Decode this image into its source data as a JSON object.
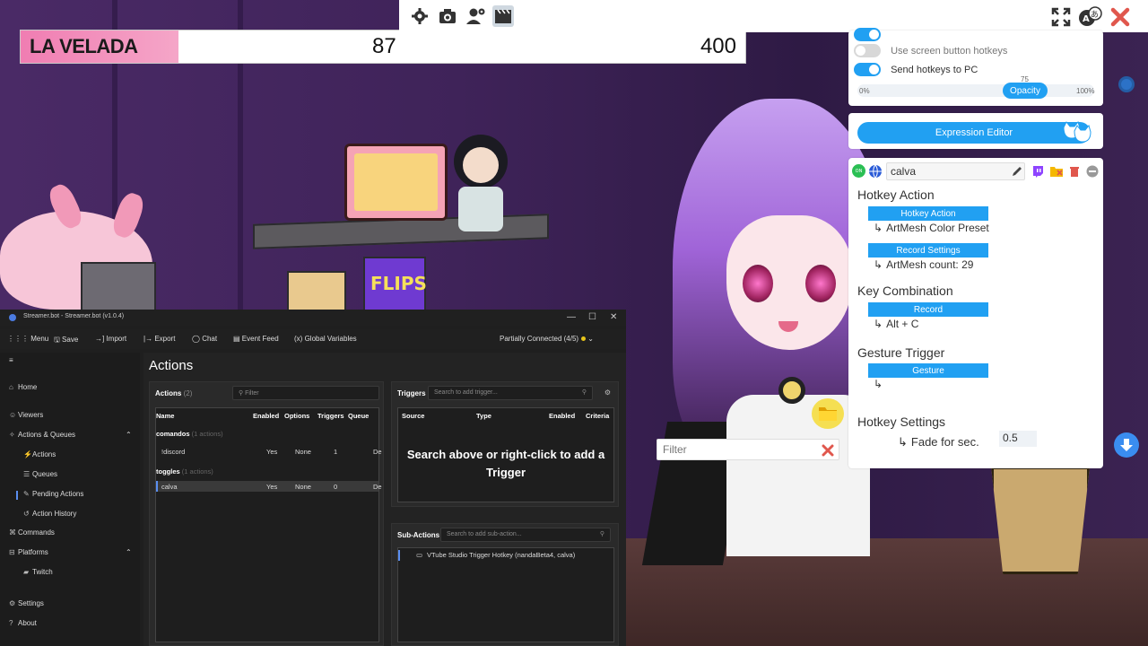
{
  "scoreboard": {
    "title": "LA VELADA",
    "value_left": "87",
    "value_right": "400"
  },
  "scene": {
    "box_label": "FLIPS"
  },
  "vtube": {
    "toolbar_icons": [
      "gear-icon",
      "camera-icon",
      "user-gear-icon",
      "clapperboard-icon"
    ],
    "right_icons": [
      "fullscreen-icon",
      "translate-icon",
      "close-icon"
    ],
    "settings": {
      "use_screen_button_hotkeys": "Use screen button hotkeys",
      "send_hotkeys_to_pc": "Send hotkeys to PC",
      "opacity_value": "75",
      "opacity_min": "0%",
      "opacity_label": "Opacity",
      "opacity_max": "100%"
    },
    "expression_editor": "Expression Editor",
    "hotkey": {
      "on_badge": "ON",
      "name": "calva",
      "hotkey_action_title": "Hotkey Action",
      "hotkey_action_button": "Hotkey Action",
      "hotkey_action_value": "ArtMesh Color Preset",
      "record_settings_button": "Record Settings",
      "artmesh_count": "ArtMesh count: 29",
      "key_combination_title": "Key Combination",
      "record_button": "Record",
      "key_combination_value": "Alt + C",
      "gesture_trigger_title": "Gesture Trigger",
      "gesture_button": "Gesture",
      "hotkey_settings_title": "Hotkey Settings",
      "fade_label": "Fade for sec.",
      "fade_value": "0.5"
    },
    "filter_placeholder": "Filter"
  },
  "streamerbot": {
    "window_title": "Streamer.bot - Streamer.bot (v1.0.4)",
    "menu": {
      "menu": "Menu",
      "save": "Save",
      "import": "Import",
      "export": "Export",
      "chat": "Chat",
      "event_feed": "Event Feed",
      "global_variables": "Global Variables",
      "status": "Partially Connected (4/5)"
    },
    "sidebar": {
      "home": "Home",
      "viewers": "Viewers",
      "actions_queues": "Actions & Queues",
      "actions": "Actions",
      "queues": "Queues",
      "pending_actions": "Pending Actions",
      "action_history": "Action History",
      "commands": "Commands",
      "platforms": "Platforms",
      "twitch": "Twitch",
      "settings": "Settings",
      "about": "About"
    },
    "main_title": "Actions",
    "actions_pane": {
      "title": "Actions",
      "count": "(2)",
      "filter_placeholder": "Filter",
      "columns": [
        "Name",
        "Enabled",
        "Options",
        "Triggers",
        "Queue"
      ],
      "groups": [
        {
          "name": "comandos",
          "count": "(1 actions)",
          "rows": [
            {
              "name": "!discord",
              "enabled": "Yes",
              "options": "None",
              "triggers": "1",
              "queue": "De"
            }
          ]
        },
        {
          "name": "toggles",
          "count": "(1 actions)",
          "rows": [
            {
              "name": "calva",
              "enabled": "Yes",
              "options": "None",
              "triggers": "0",
              "queue": "De"
            }
          ]
        }
      ]
    },
    "triggers_pane": {
      "title": "Triggers",
      "search_placeholder": "Search to add trigger...",
      "columns": [
        "Source",
        "Type",
        "Enabled",
        "Criteria"
      ],
      "hint": "Search above or right-click to add a Trigger"
    },
    "subactions_pane": {
      "title": "Sub-Actions",
      "search_placeholder": "Search to add sub-action...",
      "items": [
        "VTube Studio Trigger Hotkey (nandaBeta4, calva)"
      ]
    }
  }
}
